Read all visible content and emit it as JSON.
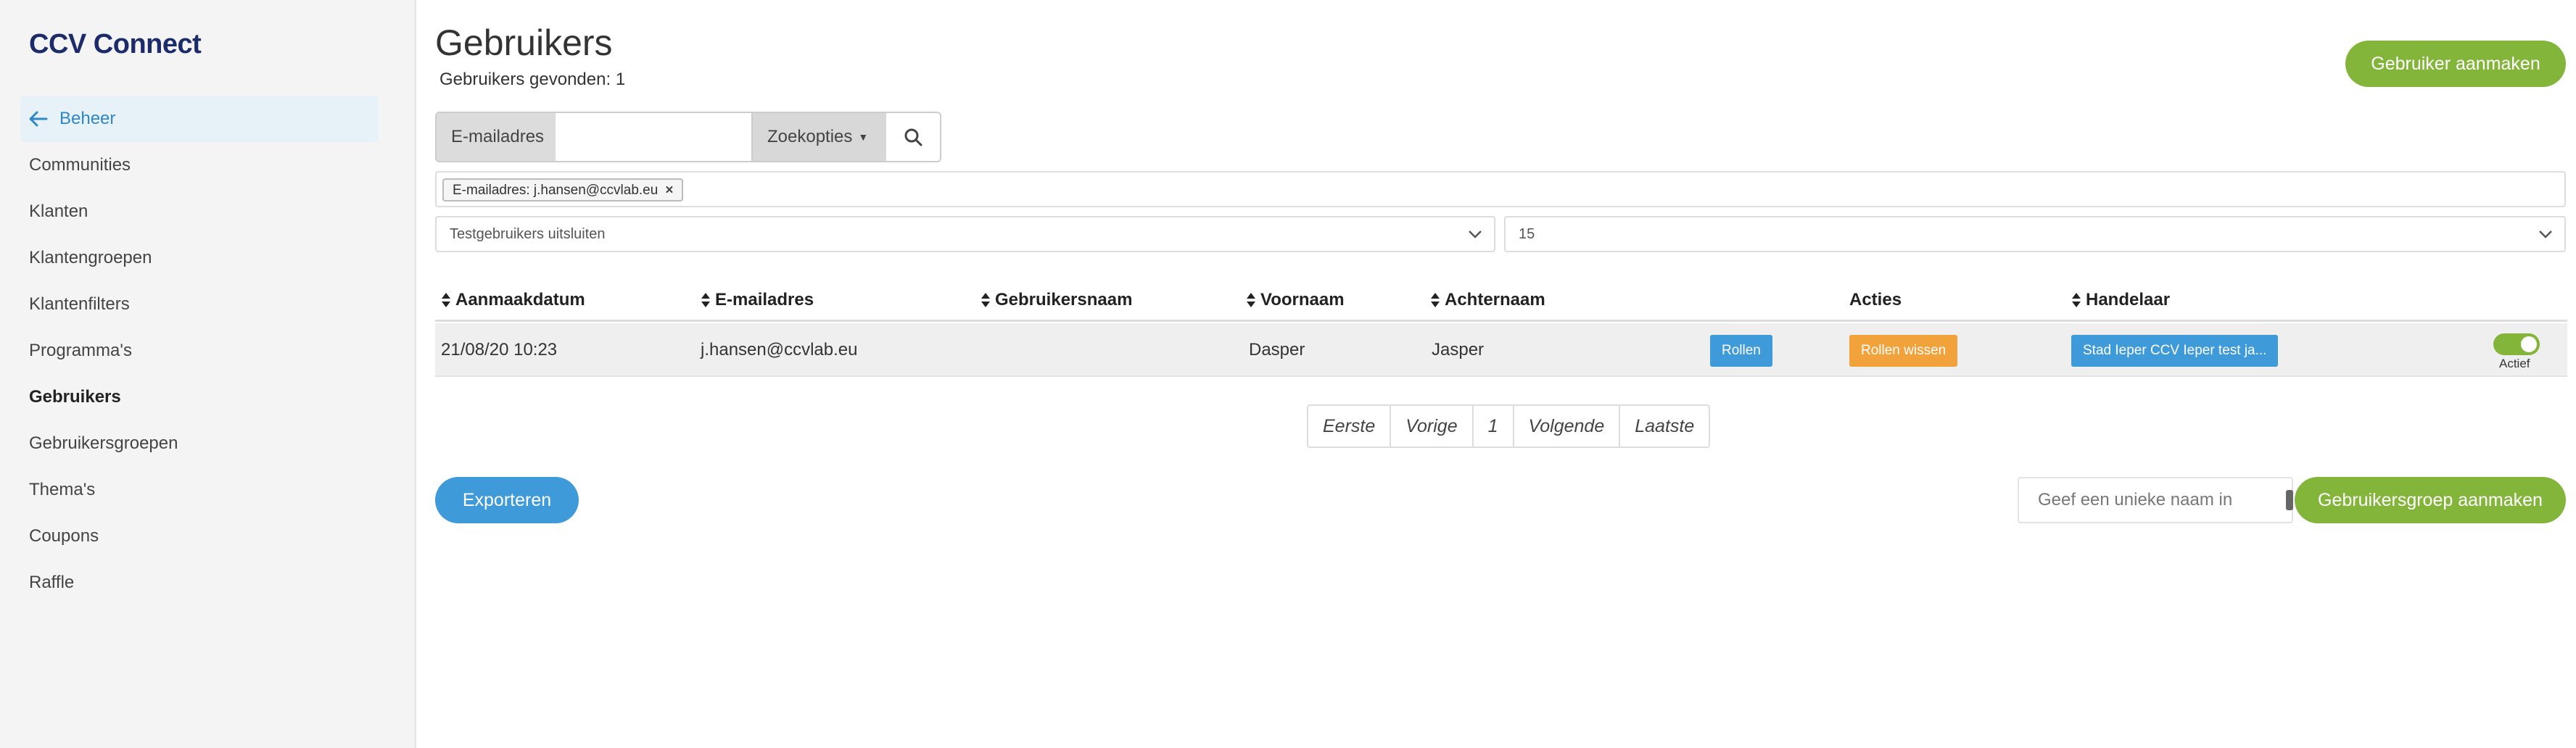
{
  "app": {
    "brand": "CCV Connect"
  },
  "sidebar": {
    "back_label": "Beheer",
    "items": [
      {
        "label": "Communities"
      },
      {
        "label": "Klanten"
      },
      {
        "label": "Klantengroepen"
      },
      {
        "label": "Klantenfilters"
      },
      {
        "label": "Programma's"
      },
      {
        "label": "Gebruikers",
        "active": true
      },
      {
        "label": "Gebruikersgroepen"
      },
      {
        "label": "Thema's"
      },
      {
        "label": "Coupons"
      },
      {
        "label": "Raffle"
      }
    ]
  },
  "page": {
    "title": "Gebruikers",
    "count_text": "Gebruikers gevonden: 1",
    "create_button": "Gebruiker aanmaken"
  },
  "search": {
    "field_label": "E-mailadres",
    "value": "",
    "options_label": "Zoekopties",
    "search_icon": "search-icon"
  },
  "filters": {
    "chip": "E-mailadres: j.hansen@ccvlab.eu",
    "test_users": "Testgebruikers uitsluiten",
    "page_size": "15"
  },
  "table": {
    "headers": {
      "created": "Aanmaakdatum",
      "email": "E-mailadres",
      "username": "Gebruikersnaam",
      "firstname": "Voornaam",
      "lastname": "Achternaam",
      "actions": "Acties",
      "merchant": "Handelaar"
    },
    "rows": [
      {
        "created": "21/08/20 10:23",
        "email": "j.hansen@ccvlab.eu",
        "username": "",
        "firstname": "Dasper",
        "lastname": "Jasper",
        "roles_button": "Rollen",
        "clear_roles_button": "Rollen wissen",
        "merchant_button": "Stad Ieper CCV Ieper test ja...",
        "status_label": "Actief",
        "active": true
      }
    ]
  },
  "pagination": {
    "first": "Eerste",
    "prev": "Vorige",
    "current": "1",
    "next": "Volgende",
    "last": "Laatste"
  },
  "footer": {
    "export_button": "Exporteren",
    "group_name_placeholder": "Geef een unieke naam in",
    "create_group_button": "Gebruikersgroep aanmaken"
  },
  "colors": {
    "primary_green": "#84b53b",
    "primary_blue": "#3e9ad8",
    "warning_orange": "#f2a23a",
    "brand_navy": "#1c2c6b"
  }
}
